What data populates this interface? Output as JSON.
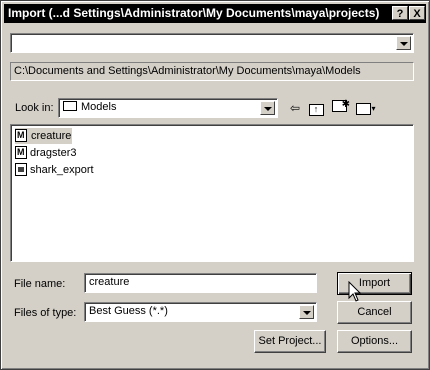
{
  "window": {
    "title": "Import (...d Settings\\Administrator\\My Documents\\maya\\projects)",
    "help_label": "?",
    "close_label": "X"
  },
  "top_combo": {
    "value": ""
  },
  "path_display": "C:\\Documents and Settings\\Administrator\\My Documents\\maya\\Models",
  "look_in": {
    "label": "Look in:",
    "value": "Models"
  },
  "toolbar": {
    "back_icon": "back-arrow-icon",
    "up_icon": "up-folder-icon",
    "new_folder_icon": "new-folder-icon",
    "view_menu_icon": "view-menu-icon"
  },
  "files": [
    {
      "name": "creature",
      "icon": "maya-file-icon",
      "selected": true
    },
    {
      "name": "dragster3",
      "icon": "maya-file-icon",
      "selected": false
    },
    {
      "name": "shark_export",
      "icon": "document-icon",
      "selected": false
    }
  ],
  "file_name": {
    "label": "File name:",
    "value": "creature"
  },
  "files_of_type": {
    "label": "Files of type:",
    "value": "Best Guess (*.*)"
  },
  "buttons": {
    "import": "Import",
    "cancel": "Cancel",
    "set_project": "Set Project...",
    "options": "Options..."
  },
  "colors": {
    "titlebar": "#000000",
    "face": "#d4d0c8",
    "selection": "#d4d0c8"
  }
}
